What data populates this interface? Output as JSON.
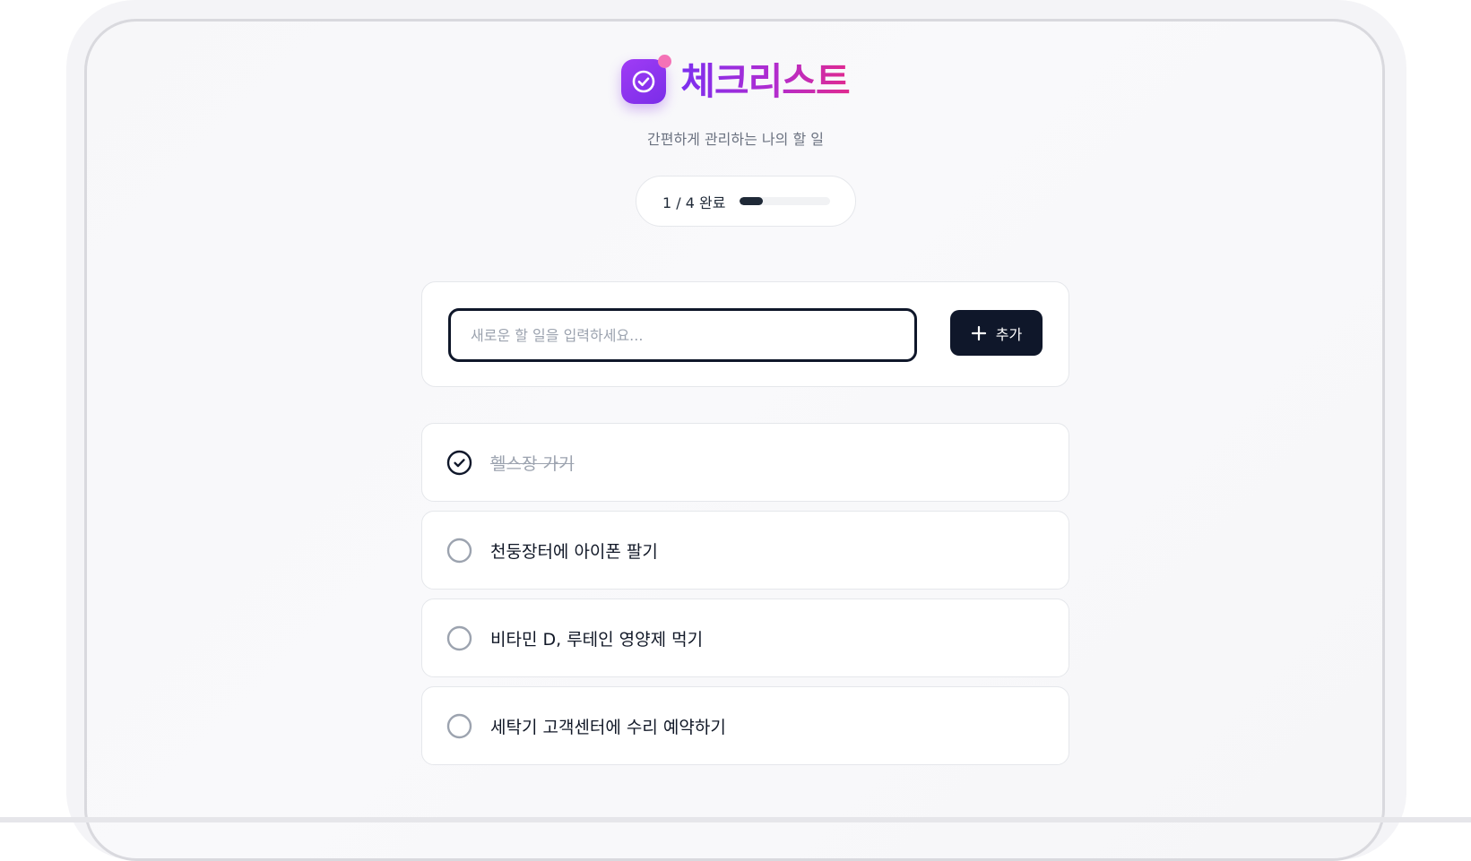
{
  "app": {
    "title": "체크리스트",
    "subtitle": "간편하게 관리하는 나의 할 일",
    "logo_icon": "check-circle-icon",
    "accent_colors": [
      "#7c2ff0",
      "#b12ccf",
      "#e02a8f"
    ]
  },
  "progress": {
    "label": "1 / 4 완료",
    "completed": 1,
    "total": 4,
    "fraction": 0.25
  },
  "input": {
    "value": "",
    "placeholder": "새로운 할 일을 입력하세요..."
  },
  "add_button": {
    "icon": "plus-icon",
    "label": "추가"
  },
  "tasks": [
    {
      "text": "헬스장 가기",
      "done": true
    },
    {
      "text": "천둥장터에 아이폰 팔기",
      "done": false
    },
    {
      "text": "비타민 D, 루테인 영양제 먹기",
      "done": false
    },
    {
      "text": "세탁기 고객센터에 수리 예약하기",
      "done": false
    }
  ]
}
